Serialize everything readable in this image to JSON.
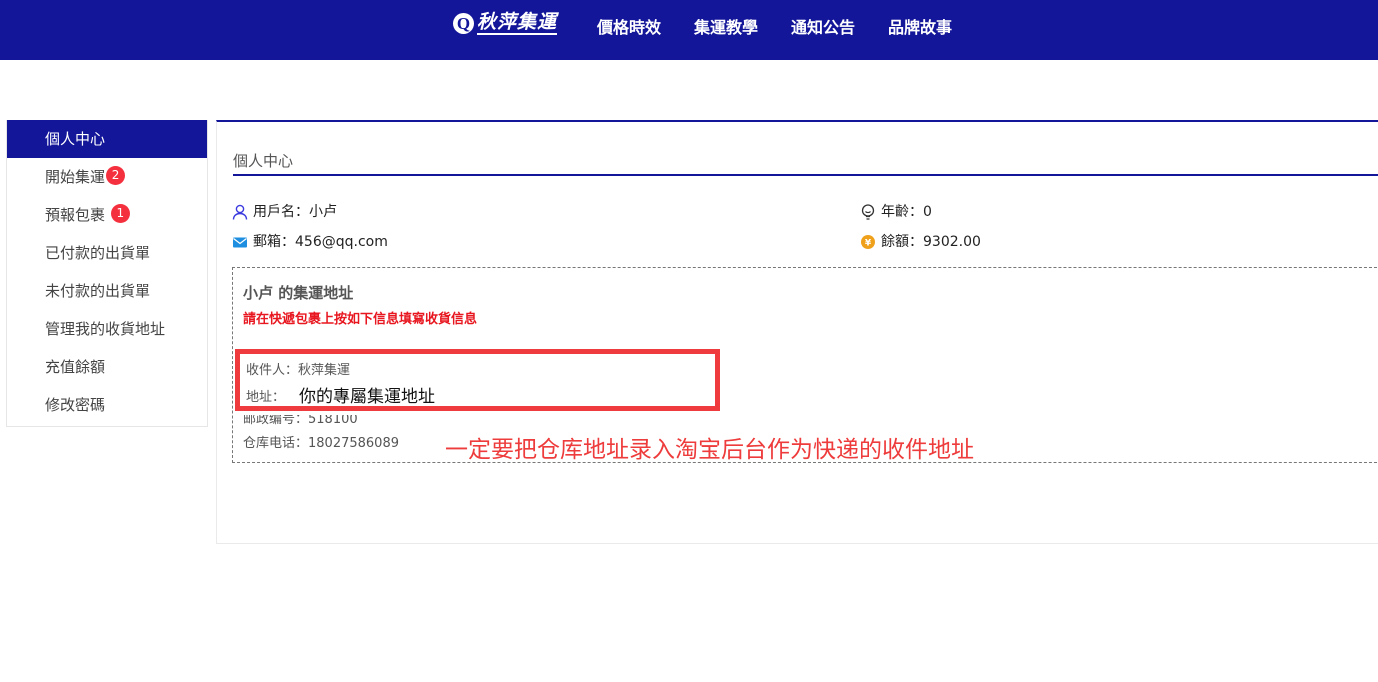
{
  "header": {
    "logo_mark": "Q",
    "logo_text": "秋萍集運",
    "nav": [
      "價格時效",
      "集運教學",
      "通知公告",
      "品牌故事"
    ]
  },
  "sidebar": {
    "items": [
      {
        "label": "個人中心",
        "active": true
      },
      {
        "label": "開始集運",
        "badge": "2"
      },
      {
        "label": "預報包裹",
        "badge": "1"
      },
      {
        "label": "已付款的出貨單"
      },
      {
        "label": "未付款的出貨單"
      },
      {
        "label": "管理我的收貨地址"
      },
      {
        "label": "充值餘額"
      },
      {
        "label": "修改密碼"
      }
    ]
  },
  "profile": {
    "title": "個人中心",
    "username_label": "用戶名：",
    "username": "小卢",
    "email_label": "郵箱：",
    "email": "456@qq.com",
    "age_label": "年齡：",
    "age": "0",
    "balance_label": "餘額：",
    "balance": "9302.00"
  },
  "address": {
    "title": "小卢 的集運地址",
    "warning": "請在快遞包裹上按如下信息填寫收貨信息",
    "recipient_label": "收件人：",
    "recipient": "秋萍集運",
    "addr_label": "地址：",
    "addr_value": "你的專屬集運地址",
    "postcode_partial": "邮政编号：518100",
    "phone_label": "仓库电话：",
    "phone": "18027586089",
    "annotation": "一定要把仓库地址录入淘宝后台作为快递的收件地址"
  },
  "colors": {
    "brand": "#14169a",
    "badge": "#f5303e",
    "warning": "#e8161f",
    "annotation": "#ee3b3b"
  }
}
